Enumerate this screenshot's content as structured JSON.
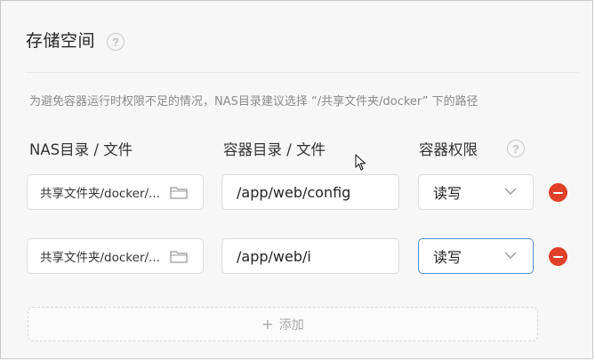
{
  "section": {
    "title": "存储空间",
    "hint": "为避免容器运行时权限不足的情况，NAS目录建议选择 “/共享文件夹/docker” 下的路径"
  },
  "columns": {
    "nas": "NAS目录 / 文件",
    "container": "容器目录 / 文件",
    "permission": "容器权限"
  },
  "rows": [
    {
      "nas_path": "共享文件夹/docker/...",
      "container_path": "/app/web/config",
      "permission": "读写"
    },
    {
      "nas_path": "共享文件夹/docker/...",
      "container_path": "/app/web/i",
      "permission": "读写"
    }
  ],
  "add_label": "添加",
  "icons": {
    "help": "question-circle-icon",
    "folder": "folder-icon",
    "dropdown": "chevron-down-icon",
    "remove": "minus-circle-icon",
    "add": "plus-icon",
    "cursor": "mouse-pointer-icon"
  },
  "colors": {
    "remove": "#e0402a",
    "focus_border": "#4a8fe4",
    "panel_bg": "#f7f7f7"
  }
}
